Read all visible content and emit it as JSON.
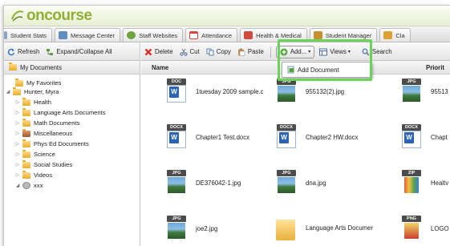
{
  "app": {
    "logo_text": "oncourse"
  },
  "tabs": [
    {
      "label": "Student Stats",
      "color": "#8aa4c8"
    },
    {
      "label": "Message Center",
      "color": "#5e8dc2"
    },
    {
      "label": "Staff Websites",
      "color": "#6fa33f"
    },
    {
      "label": "Attendance",
      "color": "#d9453b"
    },
    {
      "label": "Health & Medical",
      "color": "#d24a3e"
    },
    {
      "label": "Student Manager",
      "color": "#c78f2e"
    },
    {
      "label": "Cla",
      "color": "#e0a030"
    }
  ],
  "left_toolbar": {
    "refresh": "Refresh",
    "expand": "Expand/Collapse All"
  },
  "toolbar": {
    "delete": "Delete",
    "cut": "Cut",
    "copy": "Copy",
    "paste": "Paste",
    "add": "Add...",
    "views": "Views",
    "search": "Search"
  },
  "add_menu": {
    "item": "Add Document"
  },
  "tree": {
    "header": "My Documents",
    "nodes": [
      {
        "label": "My Favorites"
      },
      {
        "label": "Hunter, Myra"
      },
      {
        "label": "Health"
      },
      {
        "label": "Language Arts Documents"
      },
      {
        "label": "Math Documents"
      },
      {
        "label": "Miscellaneous"
      },
      {
        "label": "Phys Ed Documents"
      },
      {
        "label": "Science"
      },
      {
        "label": "Social Studies"
      },
      {
        "label": "Videos"
      },
      {
        "label": "xxx"
      }
    ]
  },
  "columns": {
    "name": "Name",
    "priority": "Priorit"
  },
  "files": [
    {
      "name": "1tuesday 2009 sample.c",
      "type": "DOC"
    },
    {
      "name": "955132(2).jpg",
      "type": "JPG"
    },
    {
      "name": "95513",
      "type": "JPG"
    },
    {
      "name": "Chapter1 Test.docx",
      "type": "DOCX"
    },
    {
      "name": "Chapter2 HW.docx",
      "type": "DOCX"
    },
    {
      "name": "Chapt",
      "type": "DOCX"
    },
    {
      "name": "DE376042-1.jpg",
      "type": "JPG"
    },
    {
      "name": "dna.jpg",
      "type": "JPG"
    },
    {
      "name": "Healtv",
      "type": "ZIP"
    },
    {
      "name": "joe2.jpg",
      "type": "JPG"
    },
    {
      "name": "Language Arts Documer",
      "type": "folder"
    },
    {
      "name": "LOGO",
      "type": "PNG"
    }
  ]
}
